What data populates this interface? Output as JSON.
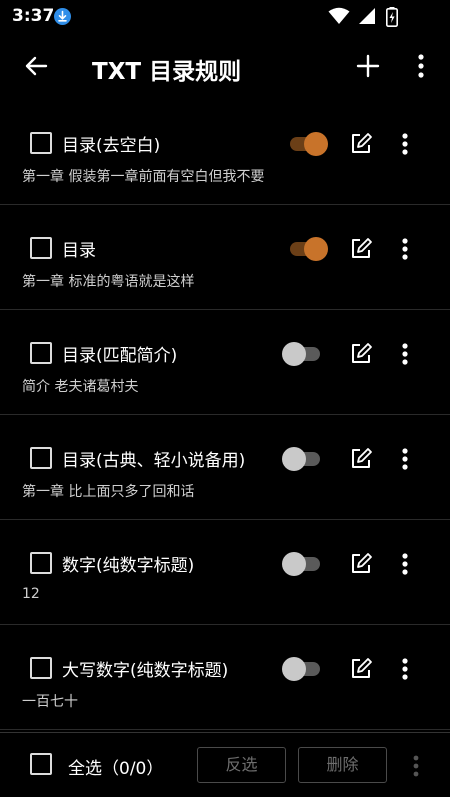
{
  "status_bar": {
    "time": "3:37"
  },
  "app_bar": {
    "title": "TXT 目录规则"
  },
  "rules": [
    {
      "name": "目录(去空白)",
      "example": "第一章 假装第一章前面有空白但我不要",
      "enabled": true
    },
    {
      "name": "目录",
      "example": "第一章 标准的粤语就是这样",
      "enabled": true
    },
    {
      "name": "目录(匹配简介)",
      "example": "简介 老夫诸葛村夫",
      "enabled": false
    },
    {
      "name": "目录(古典、轻小说备用)",
      "example": "第一章 比上面只多了回和话",
      "enabled": false
    },
    {
      "name": "数字(纯数字标题)",
      "example": "12",
      "enabled": false
    },
    {
      "name": "大写数字(纯数字标题)",
      "example": "一百七十",
      "enabled": false
    }
  ],
  "bottom_bar": {
    "select_all_label": "全选（0/0）",
    "revert_label": "反选",
    "delete_label": "删除"
  },
  "colors": {
    "accent": "#c8732a",
    "accent_track": "#6b3f17",
    "background": "#000000",
    "download_badge": "#2f8ee9"
  },
  "icons": {
    "download": "download-icon",
    "wifi": "wifi-icon",
    "signal": "signal-icon",
    "battery": "battery-charging-icon",
    "back": "arrow-back-icon",
    "add": "plus-icon",
    "menu": "more-vertical-icon",
    "edit": "edit-icon"
  }
}
